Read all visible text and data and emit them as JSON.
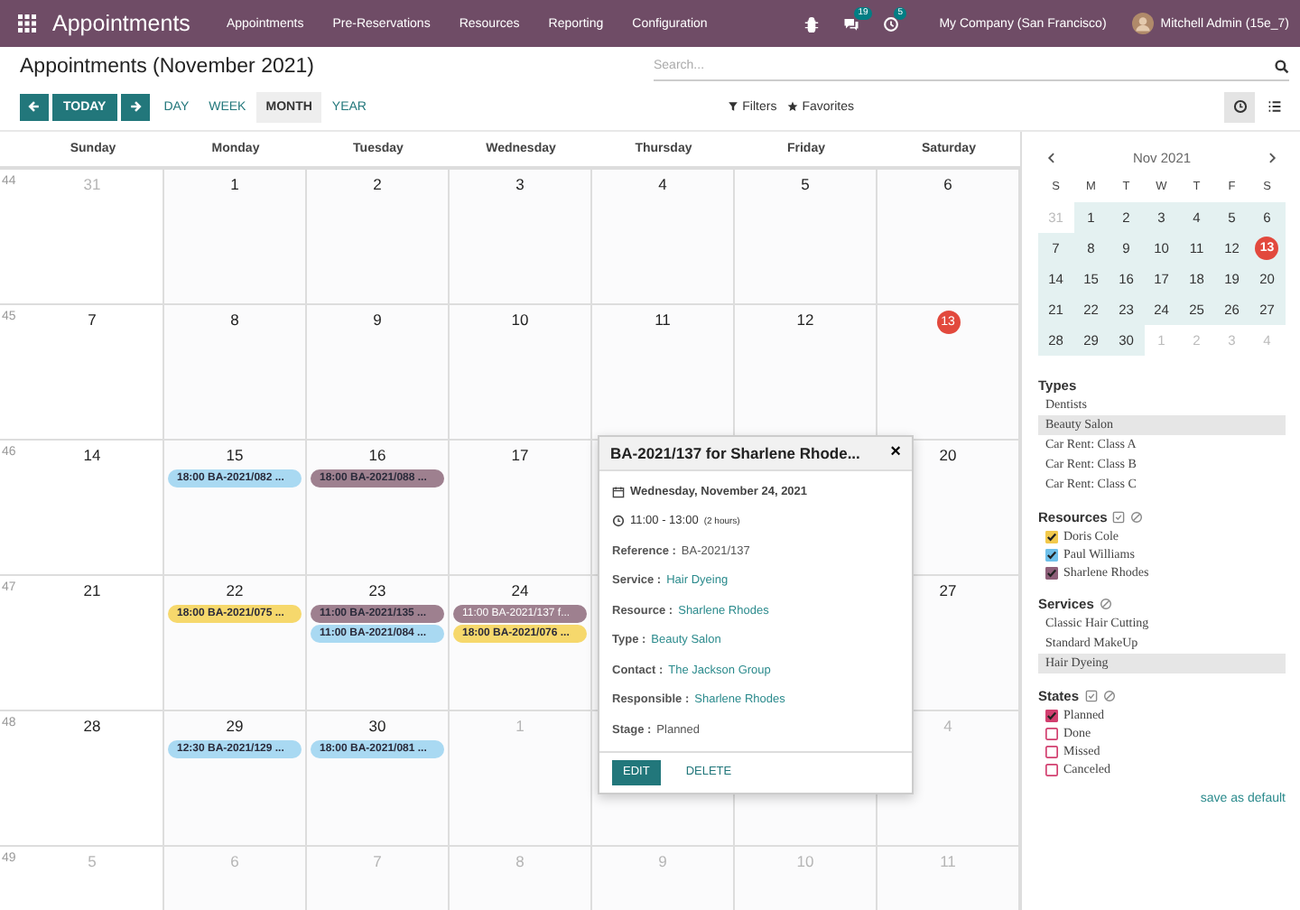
{
  "nav": {
    "app": "Appointments",
    "menus": [
      "Appointments",
      "Pre-Reservations",
      "Resources",
      "Reporting",
      "Configuration"
    ],
    "messages_badge": "19",
    "activity_badge": "5",
    "company": "My Company (San Francisco)",
    "user": "Mitchell Admin (15e_7)"
  },
  "header": {
    "title": "Appointments (November 2021)",
    "search": {
      "placeholder": "Search..."
    },
    "today": "TODAY",
    "scales": [
      {
        "label": "DAY",
        "selected": false
      },
      {
        "label": "WEEK",
        "selected": false
      },
      {
        "label": "MONTH",
        "selected": true
      },
      {
        "label": "YEAR",
        "selected": false
      }
    ],
    "filters": "Filters",
    "favorites": "Favorites",
    "views": [
      {
        "kind": "calendar",
        "selected": true
      },
      {
        "kind": "list",
        "selected": false
      }
    ]
  },
  "calendar": {
    "weekdays": [
      "Sunday",
      "Monday",
      "Tuesday",
      "Wednesday",
      "Thursday",
      "Friday",
      "Saturday"
    ],
    "weeks": [
      {
        "number": "44",
        "days": [
          {
            "day": "31",
            "muted": true
          },
          {
            "day": "1",
            "muted": false
          },
          {
            "day": "2",
            "muted": false
          },
          {
            "day": "3",
            "muted": false
          },
          {
            "day": "4",
            "muted": false
          },
          {
            "day": "5",
            "muted": false
          },
          {
            "day": "6",
            "muted": false
          }
        ]
      },
      {
        "number": "45",
        "days": [
          {
            "day": "7",
            "muted": false
          },
          {
            "day": "8",
            "muted": false
          },
          {
            "day": "9",
            "muted": false
          },
          {
            "day": "10",
            "muted": false
          },
          {
            "day": "11",
            "muted": false
          },
          {
            "day": "12",
            "muted": false
          },
          {
            "day": "13",
            "muted": false,
            "today": true
          }
        ]
      },
      {
        "number": "46",
        "days": [
          {
            "day": "14",
            "muted": false
          },
          {
            "day": "15",
            "muted": false,
            "events": [
              {
                "text": "18:00 BA-2021/082 ...",
                "color": "#a9d9f2",
                "selected": false
              }
            ]
          },
          {
            "day": "16",
            "muted": false,
            "events": [
              {
                "text": "18:00 BA-2021/088 ...",
                "color": "#9e808f",
                "selected": false
              }
            ]
          },
          {
            "day": "17",
            "muted": false
          },
          {
            "day": "20",
            "muted": false
          }
        ]
      },
      {
        "number": "47",
        "days": [
          {
            "day": "21",
            "muted": false
          },
          {
            "day": "22",
            "muted": false,
            "events": [
              {
                "text": "18:00 BA-2021/075 ...",
                "color": "#f6d86c",
                "selected": false
              }
            ]
          },
          {
            "day": "23",
            "muted": false,
            "events": [
              {
                "text": "11:00 BA-2021/135 ...",
                "color": "#9e808f",
                "selected": false
              },
              {
                "text": "11:00 BA-2021/084 ...",
                "color": "#a9d9f2",
                "selected": false
              }
            ]
          },
          {
            "day": "24",
            "muted": false,
            "events": [
              {
                "text": "11:00 BA-2021/137 f...",
                "color": "#9e808f",
                "selected": true
              },
              {
                "text": "18:00 BA-2021/076 ...",
                "color": "#f6d86c",
                "selected": false
              }
            ]
          },
          {
            "day": "27",
            "muted": false
          }
        ]
      },
      {
        "number": "48",
        "days": [
          {
            "day": "28",
            "muted": false
          },
          {
            "day": "29",
            "muted": false,
            "events": [
              {
                "text": "12:30 BA-2021/129 ...",
                "color": "#a9d9f2",
                "selected": false
              }
            ]
          },
          {
            "day": "30",
            "muted": false,
            "events": [
              {
                "text": "18:00 BA-2021/081 ...",
                "color": "#a9d9f2",
                "selected": false
              }
            ]
          },
          {
            "day": "1",
            "muted": true
          },
          {
            "day": "4",
            "muted": true
          }
        ]
      },
      {
        "number": "49",
        "days": [
          {
            "day": "5",
            "muted": true
          },
          {
            "day": "6",
            "muted": true
          },
          {
            "day": "7",
            "muted": true
          },
          {
            "day": "8",
            "muted": true
          },
          {
            "day": "9",
            "muted": true
          },
          {
            "day": "10",
            "muted": true
          },
          {
            "day": "11",
            "muted": true
          }
        ]
      }
    ],
    "popover": {
      "title": "BA-2021/137 for Sharlene Rhode...",
      "close": "×",
      "date": "Wednesday, November 24, 2021",
      "time": "11:00 - 13:00",
      "duration": "(2 hours)",
      "fields": [
        {
          "label": "Reference :",
          "value": "BA-2021/137",
          "link": false
        },
        {
          "label": "Service :",
          "value": "Hair Dyeing",
          "link": true
        },
        {
          "label": "Resource :",
          "value": "Sharlene Rhodes",
          "link": true
        },
        {
          "label": "Type :",
          "value": "Beauty Salon",
          "link": true
        },
        {
          "label": "Contact :",
          "value": "The Jackson Group",
          "link": true
        },
        {
          "label": "Responsible :",
          "value": "Sharlene Rhodes",
          "link": true
        },
        {
          "label": "Stage :",
          "value": "Planned",
          "link": false
        }
      ],
      "edit": "EDIT",
      "delete": "DELETE"
    }
  },
  "sidebar": {
    "mini_calendar": {
      "month": "Nov 2021",
      "weekdays": [
        "S",
        "M",
        "T",
        "W",
        "T",
        "F",
        "S"
      ],
      "weeks": [
        [
          {
            "day": "31",
            "muted": true
          },
          {
            "day": "1",
            "muted": false
          },
          {
            "day": "2",
            "muted": false
          },
          {
            "day": "3",
            "muted": false
          },
          {
            "day": "4",
            "muted": false
          },
          {
            "day": "5",
            "muted": false
          },
          {
            "day": "6",
            "muted": false
          }
        ],
        [
          {
            "day": "7",
            "muted": false
          },
          {
            "day": "8",
            "muted": false
          },
          {
            "day": "9",
            "muted": false
          },
          {
            "day": "10",
            "muted": false
          },
          {
            "day": "11",
            "muted": false
          },
          {
            "day": "12",
            "muted": false
          },
          {
            "day": "13",
            "muted": false,
            "today": true
          }
        ],
        [
          {
            "day": "14",
            "muted": false
          },
          {
            "day": "15",
            "muted": false
          },
          {
            "day": "16",
            "muted": false
          },
          {
            "day": "17",
            "muted": false
          },
          {
            "day": "18",
            "muted": false
          },
          {
            "day": "19",
            "muted": false
          },
          {
            "day": "20",
            "muted": false
          }
        ],
        [
          {
            "day": "21",
            "muted": false
          },
          {
            "day": "22",
            "muted": false
          },
          {
            "day": "23",
            "muted": false
          },
          {
            "day": "24",
            "muted": false
          },
          {
            "day": "25",
            "muted": false
          },
          {
            "day": "26",
            "muted": false
          },
          {
            "day": "27",
            "muted": false
          }
        ],
        [
          {
            "day": "28",
            "muted": false
          },
          {
            "day": "29",
            "muted": false
          },
          {
            "day": "30",
            "muted": false
          },
          {
            "day": "1",
            "muted": true
          },
          {
            "day": "2",
            "muted": true
          },
          {
            "day": "3",
            "muted": true
          },
          {
            "day": "4",
            "muted": true
          }
        ]
      ]
    },
    "types": {
      "title": "Types",
      "items": [
        {
          "label": "Dentists",
          "selected": false
        },
        {
          "label": "Beauty Salon",
          "selected": true
        },
        {
          "label": "Car Rent: Class A",
          "selected": false
        },
        {
          "label": "Car Rent: Class B",
          "selected": false
        },
        {
          "label": "Car Rent: Class C",
          "selected": false
        }
      ]
    },
    "resources": {
      "title": "Resources",
      "select_all": true,
      "items": [
        {
          "label": "Doris Cole",
          "checked": true,
          "color": "#f2c94c"
        },
        {
          "label": "Paul Williams",
          "checked": true,
          "color": "#6fc0ea"
        },
        {
          "label": "Sharlene Rhodes",
          "checked": true,
          "color": "#8e5f79"
        }
      ]
    },
    "services": {
      "title": "Services",
      "items": [
        {
          "label": "Classic Hair Cutting",
          "selected": false
        },
        {
          "label": "Standard MakeUp",
          "selected": false
        },
        {
          "label": "Hair Dyeing",
          "selected": true
        }
      ]
    },
    "states": {
      "title": "States",
      "select_all": true,
      "items": [
        {
          "label": "Planned",
          "checked": true,
          "color": "#d23f6f"
        },
        {
          "label": "Done",
          "checked": false,
          "color": "#d23f6f"
        },
        {
          "label": "Missed",
          "checked": false,
          "color": "#d23f6f"
        },
        {
          "label": "Canceled",
          "checked": false,
          "color": "#d23f6f"
        }
      ]
    },
    "save_default": "save as default"
  }
}
